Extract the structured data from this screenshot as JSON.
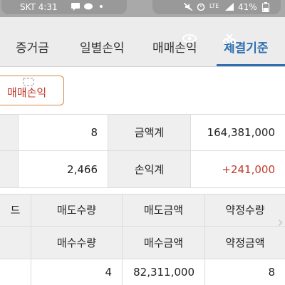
{
  "status_bar": {
    "carrier_time": "SKT 4:31",
    "lte": "LTE",
    "battery": "41%"
  },
  "tabs": [
    {
      "label": "증거금"
    },
    {
      "label": "일별손익"
    },
    {
      "label": "매매손익"
    },
    {
      "label": "체결기준"
    }
  ],
  "active_tab": "체결기준",
  "sub_button": {
    "label": "매매손익"
  },
  "summary": {
    "row1": {
      "left_label": "",
      "value": "8",
      "label": "금액계",
      "amount": "164,381,000"
    },
    "row2": {
      "left_label": "",
      "value": "2,466",
      "label": "손익계",
      "amount": "+241,000"
    }
  },
  "detail": {
    "headers_row1": [
      "드",
      "매도수량",
      "매도금액",
      "약정수량"
    ],
    "headers_row2": [
      "",
      "매수수량",
      "매수금액",
      "약정금액"
    ],
    "data_row": [
      "",
      "4",
      "82,311,000",
      "8"
    ]
  },
  "colors": {
    "accent": "#2f6fb0",
    "profit": "#c0392b",
    "header_bg": "#efefef"
  }
}
